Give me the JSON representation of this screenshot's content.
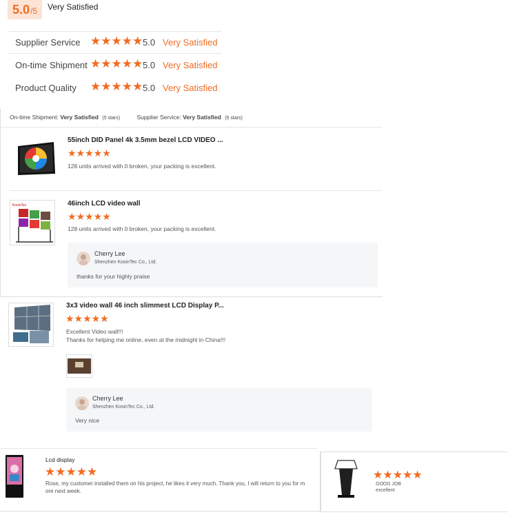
{
  "summary": {
    "score": "5.0",
    "score_suffix": "/5",
    "label": "Very Satisfied"
  },
  "ratings": [
    {
      "label": "Supplier Service",
      "score": "5.0",
      "text": "Very Satisfied"
    },
    {
      "label": "On-time Shipment",
      "score": "5.0",
      "text": "Very Satisfied"
    },
    {
      "label": "Product Quality",
      "score": "5.0",
      "text": "Very Satisfied"
    }
  ],
  "block1": {
    "shipment_label": "On-time Shipment:",
    "shipment_value": "Very Satisfied",
    "shipment_stars": "(5 stars)",
    "service_label": "Supplier Service:",
    "service_value": "Very Satisfied",
    "service_stars": "(5 stars)"
  },
  "reviews": [
    {
      "title": "55inch DID Panel 4k 3.5mm bezel LCD VIDEO ...",
      "stars": 5,
      "text": "128 units arrived with 0 broken, your packing is excellent."
    },
    {
      "title": "46inch LCD video wall",
      "stars": 5,
      "text": "128 units arrived with 0 broken, your packing is excellent.",
      "reply": {
        "name": "Cherry Lee",
        "company": "Shenzhen KosinTec Co., Ltd.",
        "message": "thanks for your highly praise"
      }
    },
    {
      "title": "3x3 video wall 46 inch slimmest LCD Display P...",
      "stars": 5,
      "line1": "Excellent Video wall!!!",
      "line2": "Thanks for helping me online, even at the midnight in China!!!",
      "reply": {
        "name": "Cherry Lee",
        "company": "Shenzhen KosinTec Co., Ltd.",
        "message": "Very nice"
      }
    },
    {
      "title": "Lcd display",
      "stars": 5,
      "line1": "Rose, my customer installed them on his project,  he likes it very much. Thank you, I will return to you for m",
      "line2": "ore next week."
    },
    {
      "stars": 5,
      "line1": "GOOD JOB",
      "line2": "excellent"
    }
  ],
  "colors": {
    "accent": "#f26b21",
    "score_bg": "#fde3d4",
    "reply_bg": "#f5f6f8"
  }
}
